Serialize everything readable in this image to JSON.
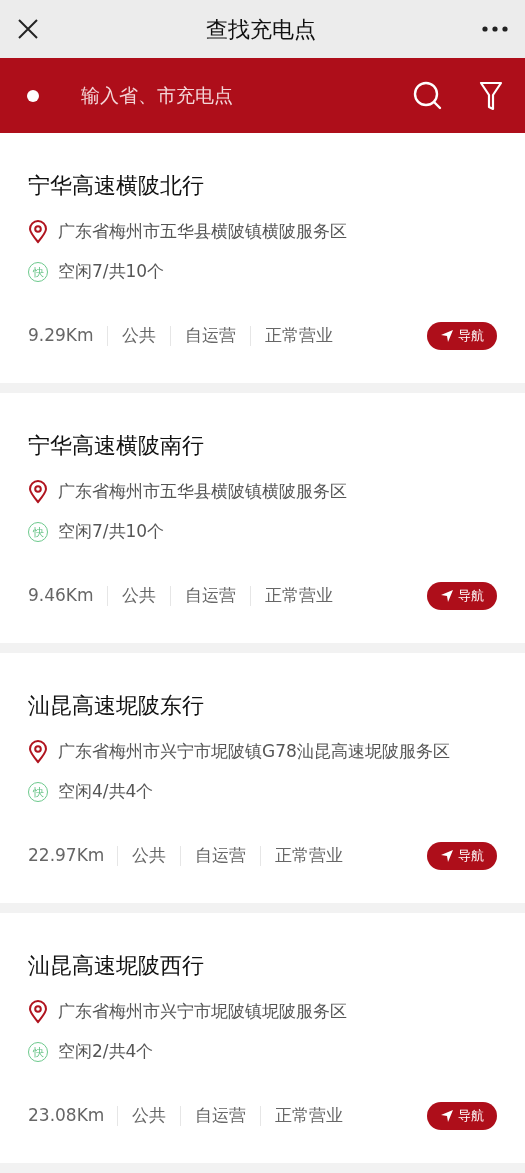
{
  "header": {
    "title": "查找充电点"
  },
  "search": {
    "placeholder": "输入省、市充电点"
  },
  "stations": [
    {
      "name": "宁华高速横陂北行",
      "address": "广东省梅州市五华县横陂镇横陂服务区",
      "speed_badge": "快",
      "availability": "空闲7/共10个",
      "distance": "9.29Km",
      "tags": [
        "公共",
        "自运营",
        "正常营业"
      ],
      "nav_label": "导航"
    },
    {
      "name": "宁华高速横陂南行",
      "address": "广东省梅州市五华县横陂镇横陂服务区",
      "speed_badge": "快",
      "availability": "空闲7/共10个",
      "distance": "9.46Km",
      "tags": [
        "公共",
        "自运营",
        "正常营业"
      ],
      "nav_label": "导航"
    },
    {
      "name": "汕昆高速坭陂东行",
      "address": "广东省梅州市兴宁市坭陂镇G78汕昆高速坭陂服务区",
      "speed_badge": "快",
      "availability": "空闲4/共4个",
      "distance": "22.97Km",
      "tags": [
        "公共",
        "自运营",
        "正常营业"
      ],
      "nav_label": "导航"
    },
    {
      "name": "汕昆高速坭陂西行",
      "address": "广东省梅州市兴宁市坭陂镇坭陂服务区",
      "speed_badge": "快",
      "availability": "空闲2/共4个",
      "distance": "23.08Km",
      "tags": [
        "公共",
        "自运营",
        "正常营业"
      ],
      "nav_label": "导航"
    }
  ]
}
